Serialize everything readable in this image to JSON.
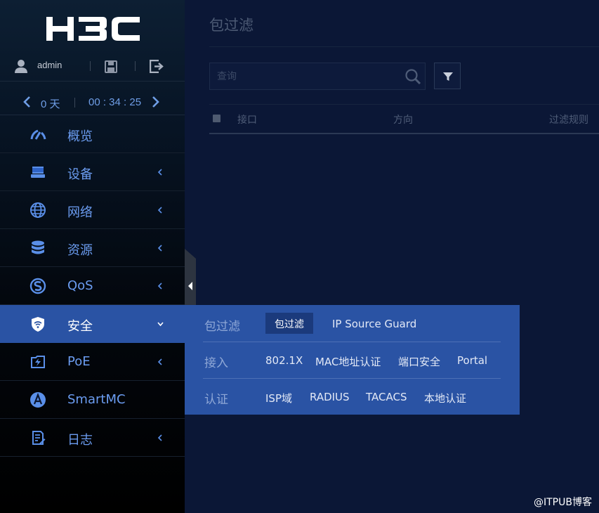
{
  "brand": {
    "logo_text": "H3C"
  },
  "user": {
    "name": "admin"
  },
  "timer": {
    "days": "0 天",
    "clock": "00 : 34 : 25"
  },
  "nav": {
    "items": [
      {
        "label": "概览",
        "icon": "dashboard-gauge-icon"
      },
      {
        "label": "设备",
        "icon": "device-icon"
      },
      {
        "label": "网络",
        "icon": "globe-icon"
      },
      {
        "label": "资源",
        "icon": "database-icon"
      },
      {
        "label": "QoS",
        "icon": "qos-icon"
      },
      {
        "label": "安全",
        "icon": "shield-wifi-icon",
        "active": true
      },
      {
        "label": "PoE",
        "icon": "poe-icon"
      },
      {
        "label": "SmartMC",
        "icon": "smartmc-icon"
      },
      {
        "label": "日志",
        "icon": "log-icon"
      }
    ]
  },
  "main": {
    "title": "包过滤",
    "search": {
      "placeholder": "查询"
    },
    "table": {
      "columns": [
        "接口",
        "方向",
        "过滤规则"
      ]
    }
  },
  "security_menu": {
    "packet_filter": {
      "category": "包过滤",
      "items": [
        "包过滤",
        "IP Source Guard"
      ]
    },
    "access": {
      "category": "接入",
      "items": [
        "802.1X",
        "MAC地址认证",
        "端口安全",
        "Portal"
      ]
    },
    "auth": {
      "category": "认证",
      "items": [
        "ISP域",
        "RADIUS",
        "TACACS",
        "本地认证"
      ]
    }
  },
  "watermark": "@ITPUB博客",
  "colors": {
    "sidebar_bg": "#000000",
    "main_bg": "#0b1736",
    "accent_blue": "#2a53a4",
    "nav_text": "#6b9cf0"
  }
}
